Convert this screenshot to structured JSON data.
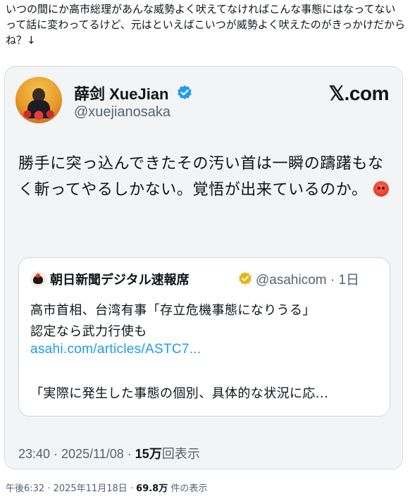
{
  "post": {
    "text": "いつの間にか高市総理があんな威勢よく吠えてなければこんな事態にはなってないって話に変わってるけど、元はといえばこいつが威勢よく吠えたのがきっかけだからね？↓"
  },
  "embedded_tweet": {
    "display_name": "薛剑 XueJian",
    "handle": "@xuejianosaka",
    "brand": "𝕏.com",
    "text": "勝手に突っ込んできたその汚い首は一瞬の躊躇もなく斬ってやるしかない。覚悟が出来ているのか。",
    "emoji": "angry-face",
    "quoted": {
      "name": "朝日新聞デジタル速報席",
      "handle_time": "@asahicom · 1日",
      "line1": "高市首相、台湾有事「存立危機事態になりうる」",
      "line2": "認定なら武力行使も",
      "link": "asahi.com/articles/ASTC7...",
      "excerpt": "「実際に発生した事態の個別、具体的な状況に応..."
    },
    "meta": {
      "time_date": "23:40 · 2025/11/08 · ",
      "views_count": "15万",
      "views_label": "回表示"
    }
  },
  "footer": {
    "time_date": "午後6:32 · 2025年11月18日 · ",
    "views_count": "69.8万",
    "views_label": " 件の表示"
  },
  "colors": {
    "verified_blue": "#1d9bf0",
    "verified_gold": "#e2b719",
    "link": "#1d9bf0"
  }
}
